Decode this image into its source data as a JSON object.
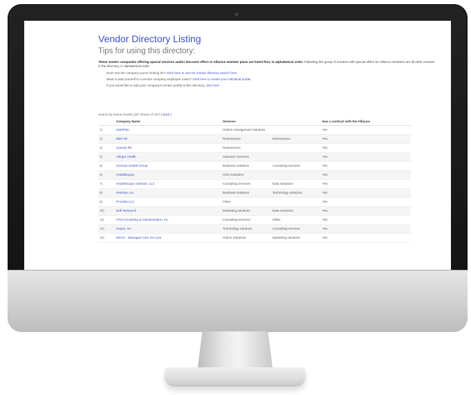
{
  "page": {
    "title": "Vendor Directory Listing",
    "subtitle": "Tips for using this directory:",
    "intro_bold": "These vendor companies offering special services and/or discount offers to Alliance member plans are listed first, in alphabetical order.",
    "intro_rest": " Following this group of vendors with special offers for Alliance members are all other vendors in the directory, in alphabetical order.",
    "tips": [
      {
        "text": "Don't see the company you're looking for? ",
        "link": "Click here to use the vendor directory search form."
      },
      {
        "text": "Want to add yourself to a vendor company employee roster? ",
        "link": "Click here to create your individual profile."
      },
      {
        "text": "If you would like to add your company's vendor profile to this directory, ",
        "link": "click here"
      }
    ],
    "results_text": "Search by Name results (197 shown of 197) | ",
    "back_link": "Back",
    "results_tail": " |"
  },
  "table": {
    "headers": [
      "Company Name",
      "Services",
      "",
      "Has a contract with the Alliance"
    ],
    "rows": [
      {
        "num": "1)",
        "name": "MultiPlan",
        "svc1": "Claims management solutions",
        "svc2": "",
        "contract": "Yes"
      },
      {
        "num": "2)",
        "name": "RBS Re",
        "svc1": "Reinsurance",
        "svc2": "Reinsurance",
        "contract": "Yes"
      },
      {
        "num": "3)",
        "name": "Summit Re",
        "svc1": "Reinsurance",
        "svc2": "",
        "contract": "Yes"
      },
      {
        "num": "4)",
        "name": "Allegra Health",
        "svc1": "Outreach Services",
        "svc2": "",
        "contract": "Yes"
      },
      {
        "num": "5)",
        "name": "Gorman Health Group",
        "svc1": "Business solutions",
        "svc2": "Consulting services",
        "contract": "Yes"
      },
      {
        "num": "6)",
        "name": "HealthEquity",
        "svc1": "CDH Solutions",
        "svc2": "",
        "contract": "Yes"
      },
      {
        "num": "7)",
        "name": "HealthScape Advisors, LLC",
        "svc1": "Consulting services",
        "svc2": "Data Solutions",
        "contract": "Yes"
      },
      {
        "num": "8)",
        "name": "Pamilva, Inc.",
        "svc1": "Business solutions",
        "svc2": "Technology solutions",
        "contract": "Yes"
      },
      {
        "num": "9)",
        "name": "Provista LLC",
        "svc1": "Other",
        "svc2": "",
        "contract": "Yes"
      },
      {
        "num": "10)",
        "name": "Deft Research",
        "svc1": "Marketing solutions",
        "svc2": "Data Solutions",
        "contract": "Yes"
      },
      {
        "num": "11)",
        "name": "First Consulting & Administration, Inc.",
        "svc1": "Consulting services",
        "svc2": "Other",
        "contract": "Yes"
      },
      {
        "num": "12)",
        "name": "Hayes, Inc.",
        "svc1": "Technology solutions",
        "svc2": "Consulting services",
        "contract": "Yes"
      },
      {
        "num": "13)",
        "name": "MCOL - Managed Care On-Line",
        "svc1": "Online Solutions",
        "svc2": "Marketing solutions",
        "contract": "Yes"
      }
    ]
  }
}
